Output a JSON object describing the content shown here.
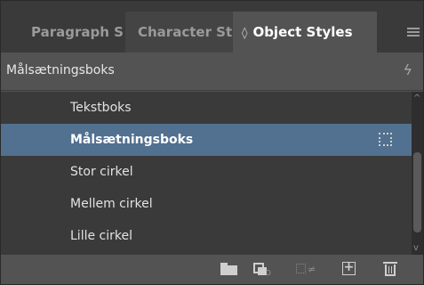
{
  "tabs": [
    {
      "label": "Paragraph S"
    },
    {
      "label": "Character St"
    },
    {
      "label": "Object Styles",
      "indicator": "◊"
    }
  ],
  "current_style": {
    "label": "Målsætningsboks"
  },
  "styles": [
    {
      "label": "Tekstboks",
      "selected": false
    },
    {
      "label": "Målsætningsboks",
      "selected": true
    },
    {
      "label": "Stor cirkel",
      "selected": false
    },
    {
      "label": "Mellem cirkel",
      "selected": false
    },
    {
      "label": "Lille cirkel",
      "selected": false
    }
  ],
  "icons": {
    "tab_indicator": "◊",
    "lightning": "ϟ",
    "scroll_up": "^",
    "scroll_down": "v"
  },
  "colors": {
    "selection": "#52708f",
    "panel": "#535353",
    "list_bg": "#3a3a3a"
  }
}
